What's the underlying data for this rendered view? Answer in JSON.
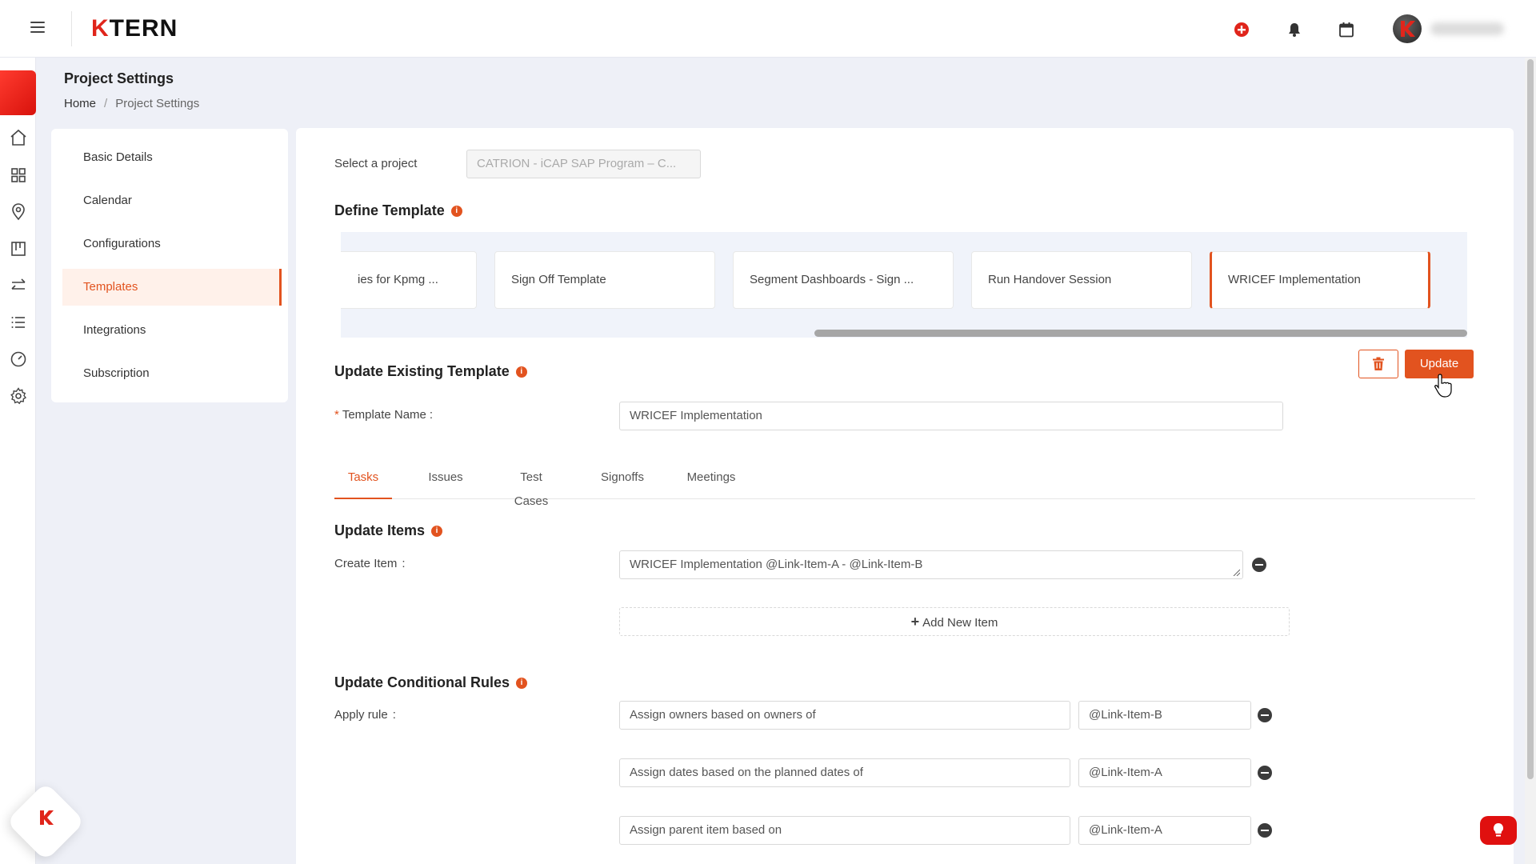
{
  "app": {
    "logo_prefix": "K",
    "logo_rest": "TERN"
  },
  "header": {
    "icons": [
      "hamburger-icon",
      "add-circle-icon",
      "bell-icon",
      "calendar-icon",
      "avatar"
    ],
    "accent_color": "#e2531f"
  },
  "page": {
    "title": "Project Settings",
    "breadcrumb": {
      "home": "Home",
      "sep": "/",
      "current": "Project Settings"
    }
  },
  "settings_nav": {
    "items": [
      "Basic Details",
      "Calendar",
      "Configurations",
      "Templates",
      "Integrations",
      "Subscription"
    ],
    "active": "Templates"
  },
  "main": {
    "select_project_label": "Select a project",
    "select_project_value": "CATRION - iCAP SAP Program – C...",
    "define_template_title": "Define Template",
    "templates": [
      "ies for Kpmg ...",
      "Sign Off Template",
      "Segment Dashboards - Sign ...",
      "Run Handover Session",
      "WRICEF Implementation"
    ],
    "selected_template": "WRICEF Implementation",
    "update_existing_title": "Update Existing Template",
    "update_button": "Update",
    "template_name_required": "*",
    "template_name_label": "Template Name",
    "template_name_colon": ":",
    "template_name_value": "WRICEF Implementation",
    "tabs": [
      "Tasks",
      "Issues",
      "Test Cases",
      "Signoffs",
      "Meetings"
    ],
    "active_tab": "Tasks",
    "update_items_title": "Update Items",
    "create_item_label": "Create Item",
    "create_item_colon": ":",
    "create_item_value": "WRICEF Implementation @Link-Item-A - @Link-Item-B",
    "add_new_item": "Add New Item",
    "conditional_rules_title": "Update Conditional Rules",
    "apply_rule_label": "Apply rule",
    "apply_rule_colon": ":",
    "rules": [
      {
        "rule": "Assign owners based on owners of",
        "target": "@Link-Item-B"
      },
      {
        "rule": "Assign dates based on the planned dates of",
        "target": "@Link-Item-A"
      },
      {
        "rule": "Assign parent item based on",
        "target": "@Link-Item-A"
      }
    ]
  }
}
